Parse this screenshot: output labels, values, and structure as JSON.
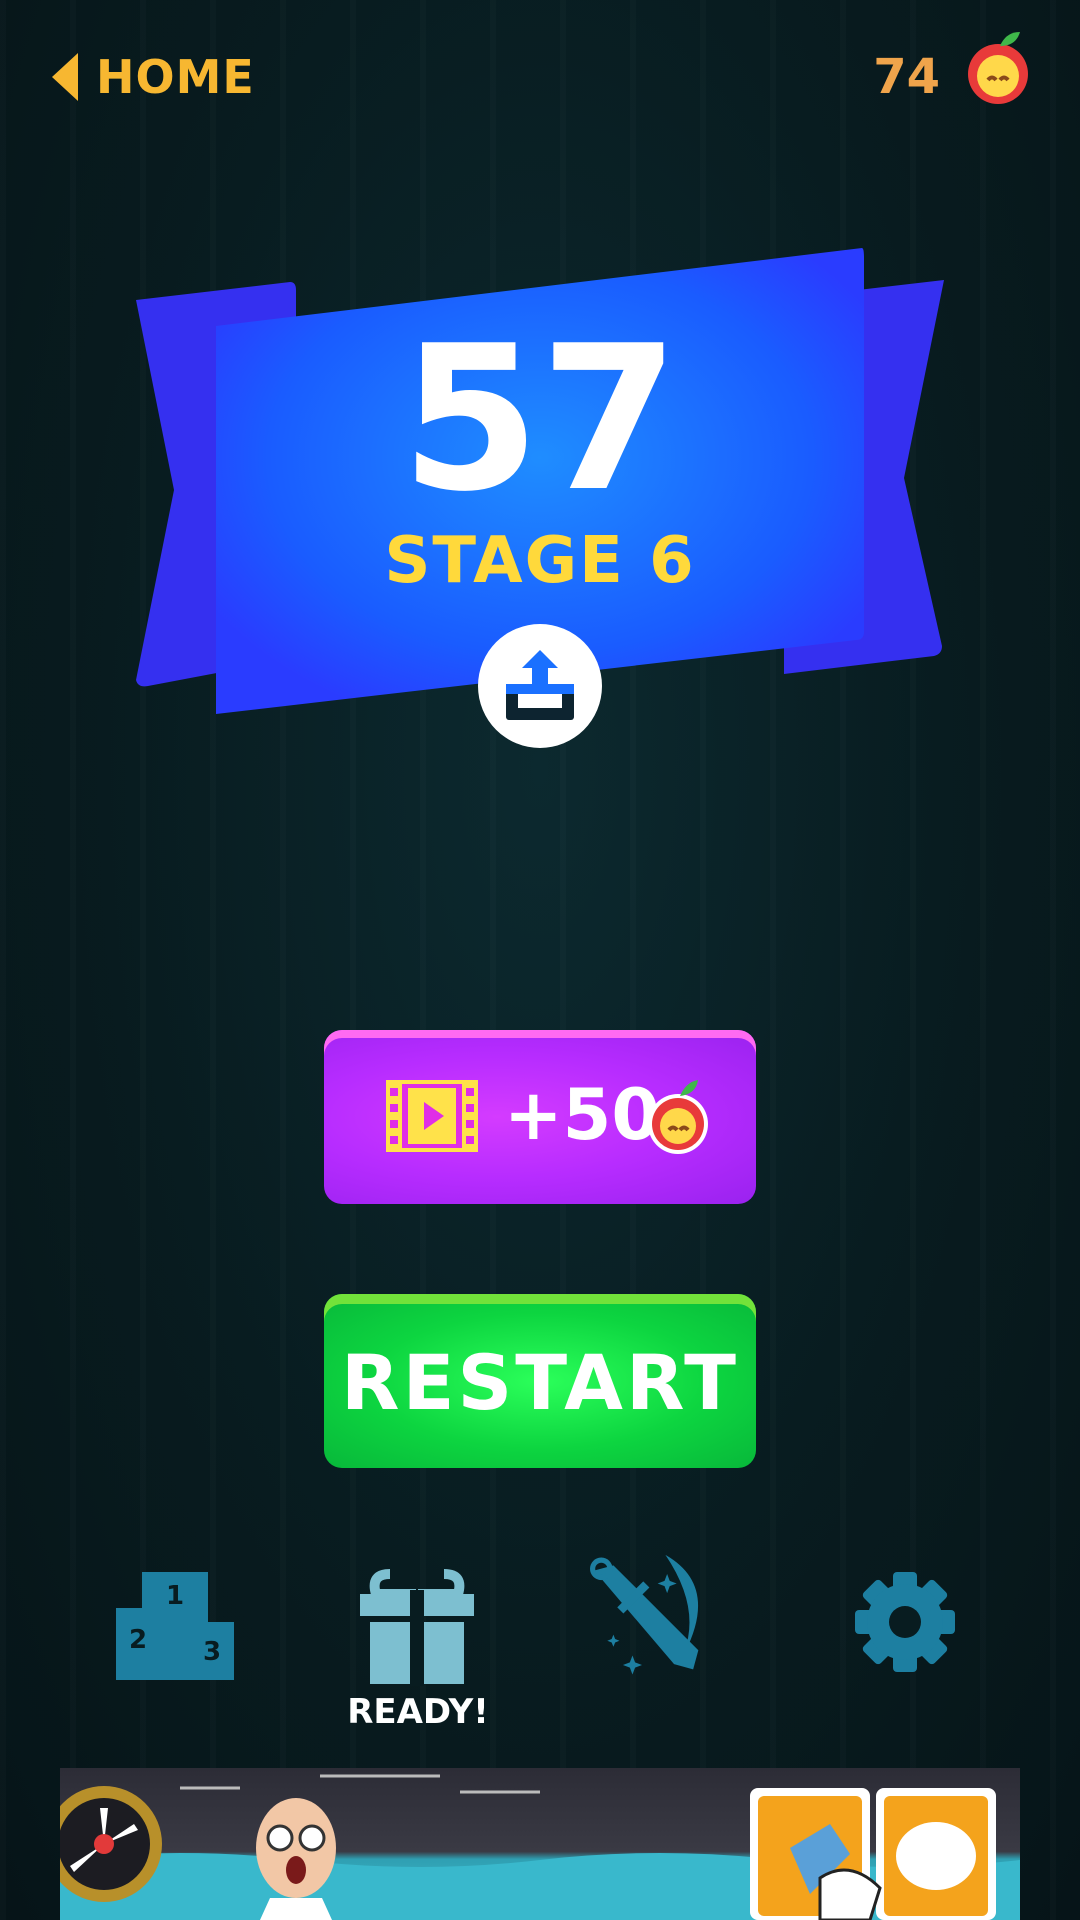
{
  "header": {
    "home_label": "HOME",
    "apple_count": "74",
    "accent_color": "#f7b731"
  },
  "result": {
    "score": "57",
    "stage": "STAGE 6"
  },
  "buttons": {
    "reward_label": "+50",
    "restart_label": "RESTART"
  },
  "bottom_nav": {
    "items": [
      {
        "name": "leaderboard-icon"
      },
      {
        "name": "gift-icon",
        "label": "READY!"
      },
      {
        "name": "skills-icon"
      },
      {
        "name": "gear-icon"
      }
    ]
  },
  "colors": {
    "banner_blue": "#1a5cff",
    "reward_purple": "#c030ff",
    "restart_green": "#10d842",
    "nav_icon": "#1d7fa1"
  }
}
